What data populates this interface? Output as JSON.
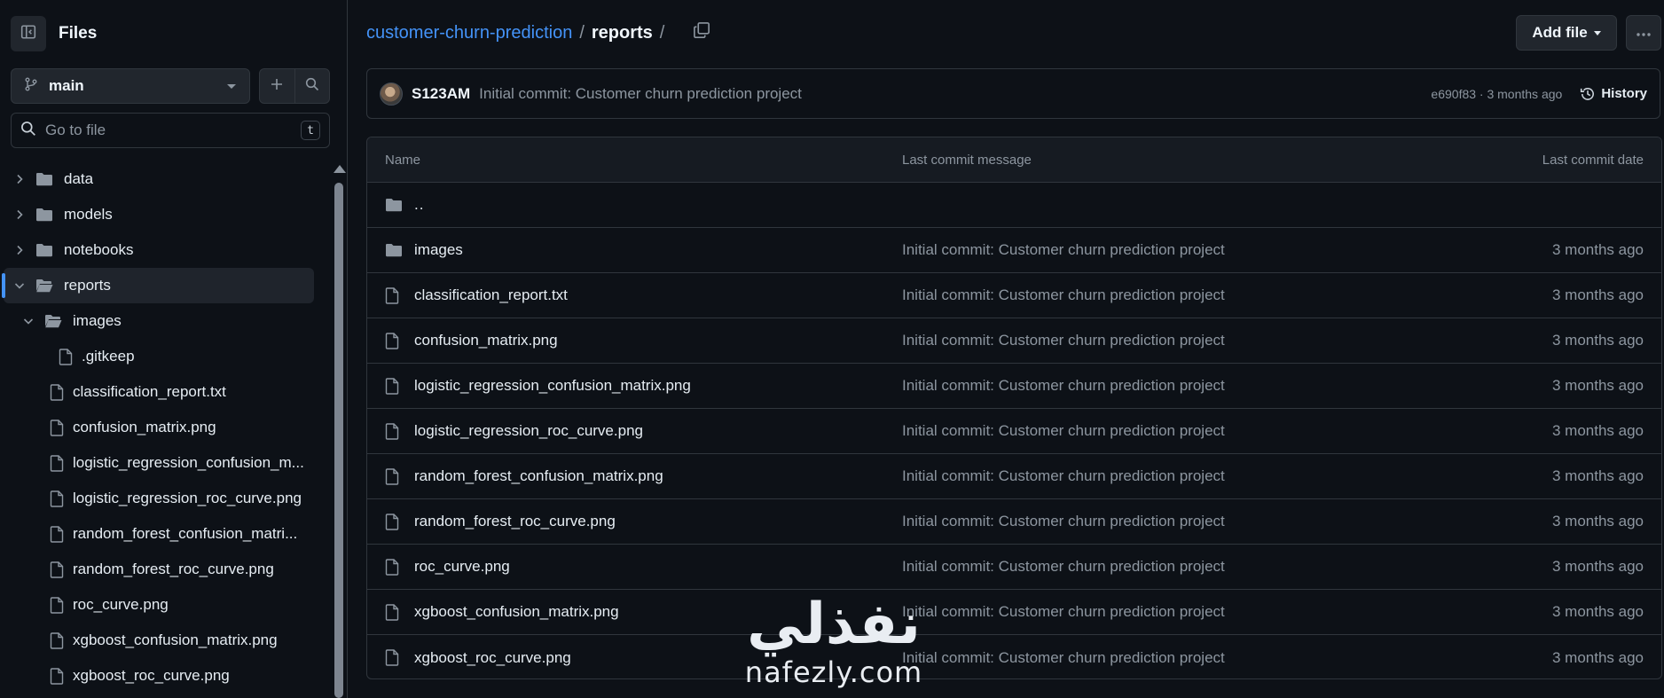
{
  "sidebar": {
    "title": "Files",
    "branch": "main",
    "goto_placeholder": "Go to file",
    "goto_shortcut": "t",
    "tree": [
      {
        "label": "data",
        "type": "folder",
        "depth": 0,
        "expanded": false
      },
      {
        "label": "models",
        "type": "folder",
        "depth": 0,
        "expanded": false
      },
      {
        "label": "notebooks",
        "type": "folder",
        "depth": 0,
        "expanded": false
      },
      {
        "label": "reports",
        "type": "folder",
        "depth": 0,
        "expanded": true,
        "selected": true
      },
      {
        "label": "images",
        "type": "folder",
        "depth": 1,
        "expanded": true
      },
      {
        "label": ".gitkeep",
        "type": "file",
        "depth": 2
      },
      {
        "label": "classification_report.txt",
        "type": "file",
        "depth": 1
      },
      {
        "label": "confusion_matrix.png",
        "type": "file",
        "depth": 1
      },
      {
        "label": "logistic_regression_confusion_m...",
        "type": "file",
        "depth": 1
      },
      {
        "label": "logistic_regression_roc_curve.png",
        "type": "file",
        "depth": 1
      },
      {
        "label": "random_forest_confusion_matri...",
        "type": "file",
        "depth": 1
      },
      {
        "label": "random_forest_roc_curve.png",
        "type": "file",
        "depth": 1
      },
      {
        "label": "roc_curve.png",
        "type": "file",
        "depth": 1
      },
      {
        "label": "xgboost_confusion_matrix.png",
        "type": "file",
        "depth": 1
      },
      {
        "label": "xgboost_roc_curve.png",
        "type": "file",
        "depth": 1
      }
    ]
  },
  "breadcrumb": {
    "repo": "customer-churn-prediction",
    "sep": "/",
    "current": "reports",
    "trailing": "/"
  },
  "actions": {
    "add_file": "Add file"
  },
  "commit": {
    "author": "S123AM",
    "message": "Initial commit: Customer churn prediction project",
    "meta": "e690f83 · 3 months ago",
    "history_label": "History"
  },
  "table": {
    "headers": {
      "name": "Name",
      "message": "Last commit message",
      "date": "Last commit date"
    },
    "parent": "..",
    "rows": [
      {
        "name": "images",
        "type": "folder",
        "message": "Initial commit: Customer churn prediction project",
        "date": "3 months ago"
      },
      {
        "name": "classification_report.txt",
        "type": "file",
        "message": "Initial commit: Customer churn prediction project",
        "date": "3 months ago"
      },
      {
        "name": "confusion_matrix.png",
        "type": "file",
        "message": "Initial commit: Customer churn prediction project",
        "date": "3 months ago"
      },
      {
        "name": "logistic_regression_confusion_matrix.png",
        "type": "file",
        "message": "Initial commit: Customer churn prediction project",
        "date": "3 months ago"
      },
      {
        "name": "logistic_regression_roc_curve.png",
        "type": "file",
        "message": "Initial commit: Customer churn prediction project",
        "date": "3 months ago"
      },
      {
        "name": "random_forest_confusion_matrix.png",
        "type": "file",
        "message": "Initial commit: Customer churn prediction project",
        "date": "3 months ago"
      },
      {
        "name": "random_forest_roc_curve.png",
        "type": "file",
        "message": "Initial commit: Customer churn prediction project",
        "date": "3 months ago"
      },
      {
        "name": "roc_curve.png",
        "type": "file",
        "message": "Initial commit: Customer churn prediction project",
        "date": "3 months ago"
      },
      {
        "name": "xgboost_confusion_matrix.png",
        "type": "file",
        "message": "Initial commit: Customer churn prediction project",
        "date": "3 months ago"
      },
      {
        "name": "xgboost_roc_curve.png",
        "type": "file",
        "message": "Initial commit: Customer churn prediction project",
        "date": "3 months ago"
      }
    ]
  },
  "watermark": {
    "arabic": "نفذلي",
    "latin": "nafezly.com"
  },
  "colors": {
    "background": "#0d1117",
    "border": "#30363d",
    "link": "#4493f8",
    "muted": "#8d96a0",
    "folder": "#8d96a0"
  }
}
